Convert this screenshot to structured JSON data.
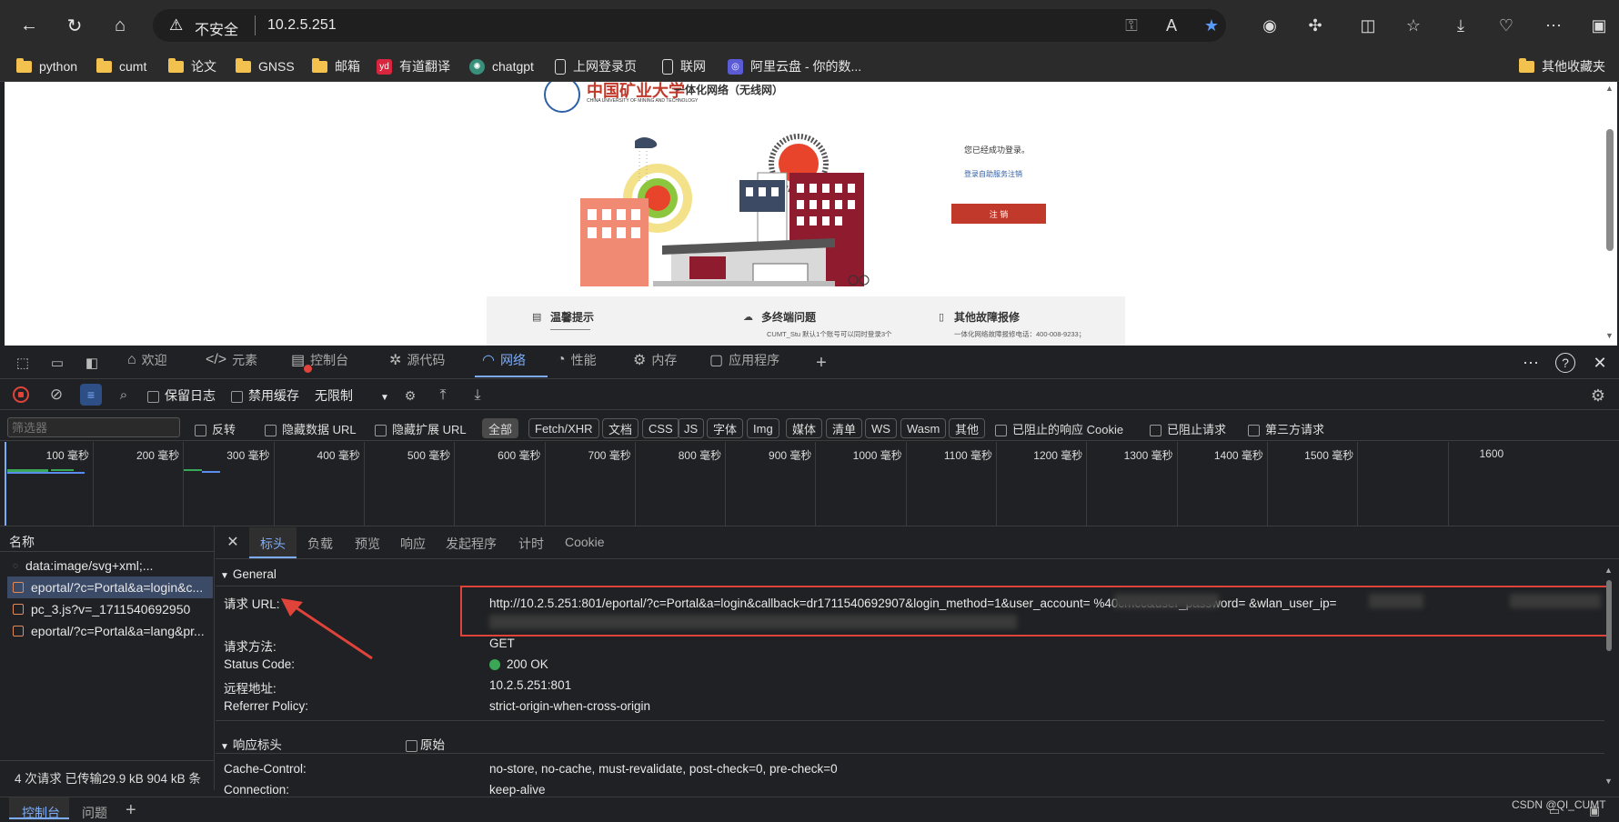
{
  "browser": {
    "insecure_label": "不安全",
    "url": "10.2.5.251"
  },
  "bookmarks": [
    {
      "label": "python",
      "icon": "folder-icon"
    },
    {
      "label": "cumt",
      "icon": "folder-icon"
    },
    {
      "label": "论文",
      "icon": "folder-icon"
    },
    {
      "label": "GNSS",
      "icon": "folder-icon"
    },
    {
      "label": "邮箱",
      "icon": "folder-icon"
    },
    {
      "label": "有道翻译",
      "icon": "youdao-icon"
    },
    {
      "label": "chatgpt",
      "icon": "chatgpt-icon"
    },
    {
      "label": "上网登录页",
      "icon": "page-icon"
    },
    {
      "label": "联网",
      "icon": "page-icon"
    },
    {
      "label": "阿里云盘 - 你的数...",
      "icon": "aliyun-icon"
    }
  ],
  "bookmarks_other": "其他收藏夹",
  "webpage": {
    "logo_title": "中国矿业大学",
    "logo_subtitle": "一体化网络（无线网）",
    "logo_english": "CHINA UNIVERSITY OF MINING AND TECHNOLOGY",
    "login_status": "您已经成功登录。",
    "self_service_link": "登录自助服务注销",
    "logout_button": "注 销",
    "info_tips_title": "温馨提示",
    "info_multi_title": "多终端问题",
    "info_multi_text": "CUMT_Stu 默认1个账号可以同时登录3个",
    "info_fault_title": "其他故障报修",
    "info_fault_text": "一体化网络故障报修电话：400-008-9233；",
    "colors": {
      "red": "#c0392b",
      "accent": "#2f5fa7"
    }
  },
  "devtools": {
    "tabs": [
      {
        "label": "欢迎",
        "icon": "home-icon"
      },
      {
        "label": "元素",
        "icon": "code-icon"
      },
      {
        "label": "控制台",
        "icon": "console-icon"
      },
      {
        "label": "源代码",
        "icon": "bug-icon"
      },
      {
        "label": "网络",
        "icon": "wifi-icon"
      },
      {
        "label": "性能",
        "icon": "gauge-icon"
      },
      {
        "label": "内存",
        "icon": "chip-icon"
      },
      {
        "label": "应用程序",
        "icon": "app-icon"
      }
    ],
    "preserve_log": "保留日志",
    "disable_cache": "禁用缓存",
    "throttle": "无限制",
    "filter_placeholder": "筛选器",
    "invert": "反转",
    "hide_data_url": "隐藏数据 URL",
    "hide_ext_url": "隐藏扩展 URL",
    "types": [
      "全部",
      "Fetch/XHR",
      "文档",
      "CSS",
      "JS",
      "字体",
      "Img",
      "媒体",
      "清单",
      "WS",
      "Wasm",
      "其他"
    ],
    "blocked_cookie": "已阻止的响应 Cookie",
    "blocked_requests": "已阻止请求",
    "third_party": "第三方请求",
    "timeline_ticks": [
      "100 毫秒",
      "200 毫秒",
      "300 毫秒",
      "400 毫秒",
      "500 毫秒",
      "600 毫秒",
      "700 毫秒",
      "800 毫秒",
      "900 毫秒",
      "1000 毫秒",
      "1100 毫秒",
      "1200 毫秒",
      "1300 毫秒",
      "1400 毫秒",
      "1500 毫秒",
      "1600"
    ],
    "name_header": "名称",
    "requests": [
      "data:image/svg+xml;...",
      "eportal/?c=Portal&a=login&c...",
      "pc_3.js?v=_1711540692950",
      "eportal/?c=Portal&a=lang&pr..."
    ],
    "detail_tabs": [
      "标头",
      "负载",
      "预览",
      "响应",
      "发起程序",
      "计时",
      "Cookie"
    ],
    "general_label": "General",
    "general": [
      {
        "key": "请求 URL:",
        "value": "http://10.2.5.251:801/eportal/?c=Portal&a=login&callback=dr1711540692907&login_method=1&user_account=          %40cmcc&user_password=        &wlan_user_ip=          "
      },
      {
        "key": "请求方法:",
        "value": "GET"
      },
      {
        "key": "Status Code:",
        "value": "200 OK"
      },
      {
        "key": "远程地址:",
        "value": "10.2.5.251:801"
      },
      {
        "key": "Referrer Policy:",
        "value": "strict-origin-when-cross-origin"
      }
    ],
    "response_headers_label": "响应标头",
    "raw_label": "原始",
    "response_headers": [
      {
        "key": "Cache-Control:",
        "value": "no-store, no-cache, must-revalidate, post-check=0, pre-check=0"
      },
      {
        "key": "Connection:",
        "value": "keep-alive"
      }
    ],
    "status_bar": "4 次请求  已传输29.9 kB  904 kB 条",
    "drawer_tabs": [
      "控制台",
      "问题"
    ],
    "watermark": "CSDN @QI_CUMT"
  }
}
